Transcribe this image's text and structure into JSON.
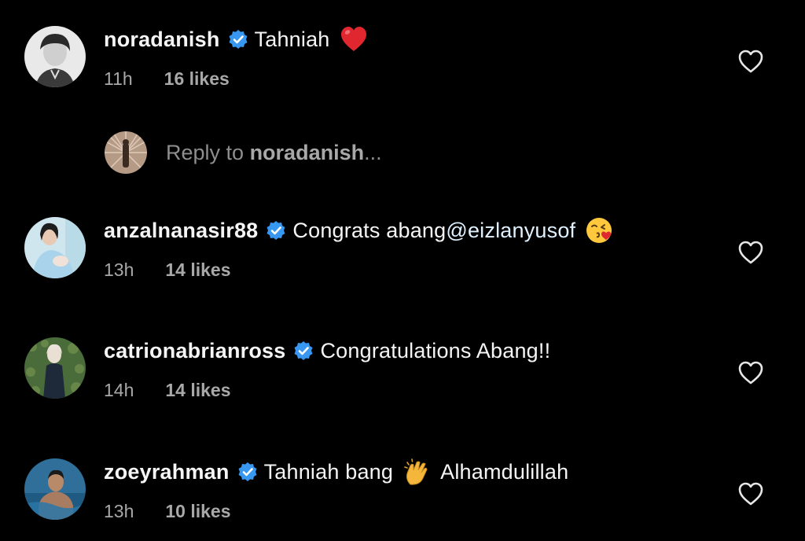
{
  "comments": [
    {
      "username": "noradanish",
      "text": "Tahniah",
      "time": "11h",
      "likes": "16 likes",
      "emoji": "red-heart"
    },
    {
      "username": "anzalnanasir88",
      "text": "Congrats abang ",
      "mention": "@eizlanyusof",
      "time": "13h",
      "likes": "14 likes",
      "emoji": "face-blowing-kiss"
    },
    {
      "username": "catrionabrianross",
      "text": "Congratulations Abang!!",
      "time": "14h",
      "likes": "14 likes"
    },
    {
      "username": "zoeyrahman",
      "text_before": "Tahniah bang",
      "text_after": "Alhamdulillah",
      "time": "13h",
      "likes": "10 likes",
      "emoji": "clapping-hands"
    }
  ],
  "reply_box": {
    "prefix": "Reply to ",
    "target": "noradanish",
    "suffix": "..."
  },
  "colors": {
    "background": "#000000",
    "verified_badge": "#3897f0",
    "secondary_text": "#a8a8a8"
  }
}
